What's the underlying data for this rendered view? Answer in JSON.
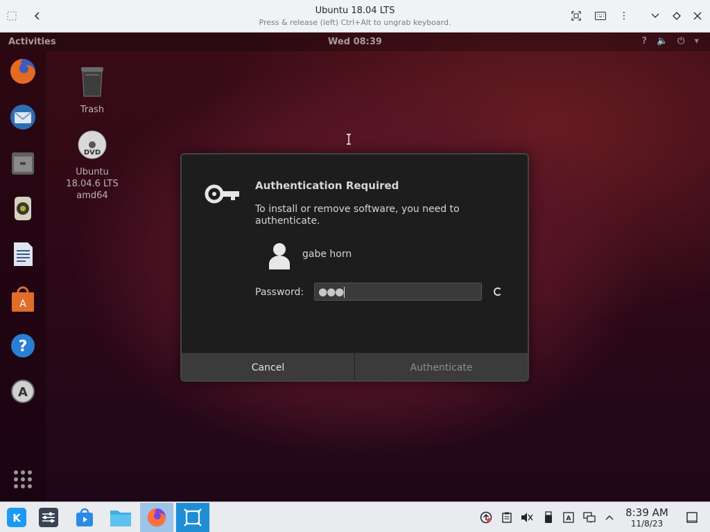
{
  "host_window": {
    "title": "Ubuntu 18.04 LTS",
    "subtitle": "Press & release (left) Ctrl+Alt to ungrab keyboard."
  },
  "gnome_topbar": {
    "activities": "Activities",
    "clock": "Wed 08:39",
    "tray_icons": [
      "help-icon",
      "volume-icon",
      "power-icon",
      "chevron-down-icon"
    ]
  },
  "dock": {
    "items": [
      "firefox-icon",
      "thunderbird-icon",
      "files-icon",
      "rhythmbox-icon",
      "libreoffice-writer-icon",
      "ubuntu-software-icon",
      "help-icon",
      "software-updater-icon"
    ],
    "show_apps_icon": "grid-icon"
  },
  "desktop": {
    "icons": [
      {
        "label": "Trash",
        "icon": "trash-icon"
      },
      {
        "label": "Ubuntu\n18.04.6 LTS\namd64",
        "line1": "Ubuntu",
        "line2": "18.04.6 LTS",
        "line3": "amd64",
        "icon": "dvd-icon"
      }
    ]
  },
  "dialog": {
    "title": "Authentication Required",
    "message": "To install or remove software, you need to authenticate.",
    "user_name": "gabe horn",
    "password_label": "Password:",
    "password_value": "●●●",
    "cancel_label": "Cancel",
    "authenticate_label": "Authenticate"
  },
  "kde_panel": {
    "time": "8:39 AM",
    "date": "11/8/23",
    "tasks": [
      "kde-launcher-icon",
      "system-settings-icon",
      "discover-icon",
      "dolphin-icon",
      "firefox-icon",
      "vm-viewer-icon"
    ],
    "tray": [
      "update-icon",
      "clipboard-icon",
      "volume-muted-icon",
      "usb-icon",
      "keyboard-layout-icon",
      "network-icon",
      "tray-expand-icon"
    ]
  },
  "colors": {
    "dialog_bg": "#1d1d1d",
    "button_bg": "#3b3b3b",
    "wallpaper_accent": "#7b1f2a",
    "panel_bg": "#e9ebee"
  }
}
